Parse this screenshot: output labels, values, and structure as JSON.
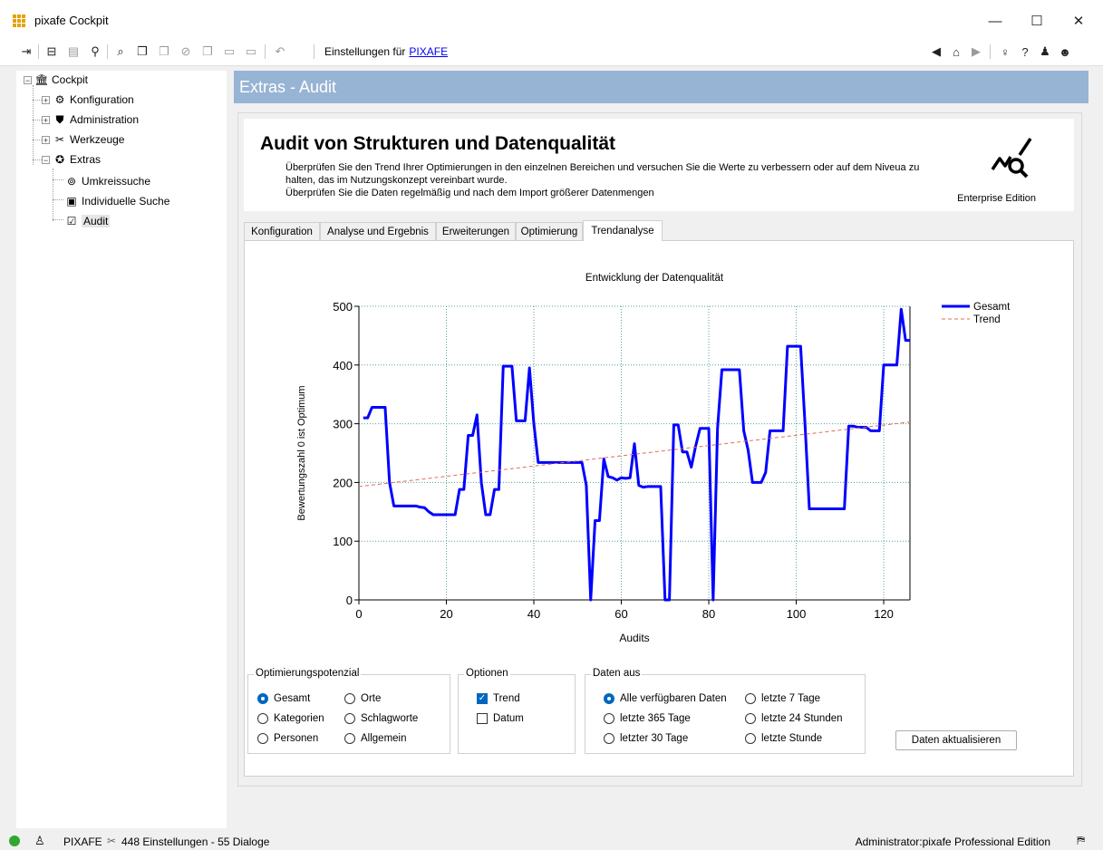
{
  "window": {
    "title": "pixafe Cockpit",
    "minimize": "—",
    "maximize": "☐",
    "close": "✕"
  },
  "toolbar": {
    "label": "Einstellungen für",
    "link": "PIXAFE"
  },
  "tree": {
    "root": "Cockpit",
    "items": [
      {
        "label": "Konfiguration",
        "icon": "gear-icon"
      },
      {
        "label": "Administration",
        "icon": "shield-icon"
      },
      {
        "label": "Werkzeuge",
        "icon": "tools-icon"
      },
      {
        "label": "Extras",
        "icon": "star-icon"
      }
    ],
    "extras_children": [
      {
        "label": "Umkreissuche",
        "icon": "location-pin-icon"
      },
      {
        "label": "Individuelle Suche",
        "icon": "search-doc-icon"
      },
      {
        "label": "Audit",
        "icon": "audit-check-icon"
      }
    ]
  },
  "page": {
    "header": "Extras - Audit",
    "title": "Audit von Strukturen und Datenqualität",
    "desc1": "Überprüfen Sie den Trend Ihrer Optimierungen in den einzelnen Bereichen und versuchen Sie die Werte zu verbessern oder auf dem Niveua zu",
    "desc2": "halten, das im Nutzungskonzept vereinbart wurde.",
    "desc3": "Überprüfen Sie die Daten regelmäßig und nach dem Import größerer Datenmengen",
    "edition": "Enterprise Edition"
  },
  "tabs": [
    "Konfiguration",
    "Analyse und Ergebnis",
    "Erweiterungen",
    "Optimierung",
    "Trendanalyse"
  ],
  "active_tab": "Trendanalyse",
  "chart_data": {
    "type": "line",
    "title": "Entwicklung der Datenqualität",
    "xlabel": "Audits",
    "ylabel": "Bewertungszahl 0 ist Optimum",
    "xlim": [
      0,
      126
    ],
    "ylim": [
      0,
      500
    ],
    "xticks": [
      0,
      20,
      40,
      60,
      80,
      100,
      120
    ],
    "yticks": [
      0,
      100,
      200,
      300,
      400,
      500
    ],
    "grid": true,
    "legend_position": "top-right",
    "series": [
      {
        "name": "Gesamt",
        "color": "#0000ff",
        "style": "solid",
        "x": [
          1,
          2,
          3,
          4,
          5,
          6,
          7,
          8,
          9,
          10,
          11,
          12,
          13,
          14,
          15,
          16,
          17,
          18,
          19,
          20,
          21,
          22,
          23,
          24,
          25,
          26,
          27,
          28,
          29,
          30,
          31,
          32,
          33,
          34,
          35,
          36,
          37,
          38,
          39,
          40,
          41,
          42,
          43,
          44,
          45,
          46,
          47,
          48,
          49,
          50,
          51,
          52,
          53,
          54,
          55,
          56,
          57,
          58,
          59,
          60,
          61,
          62,
          63,
          64,
          65,
          66,
          67,
          68,
          69,
          70,
          71,
          72,
          73,
          74,
          75,
          76,
          77,
          78,
          79,
          80,
          81,
          82,
          83,
          84,
          85,
          86,
          87,
          88,
          89,
          90,
          91,
          92,
          93,
          94,
          95,
          96,
          97,
          98,
          99,
          100,
          101,
          102,
          103,
          104,
          105,
          106,
          107,
          108,
          109,
          110,
          111,
          112,
          113,
          114,
          115,
          116,
          117,
          118,
          119,
          120,
          121,
          122,
          123,
          124,
          125,
          126
        ],
        "values": [
          310,
          310,
          328,
          328,
          328,
          328,
          200,
          160,
          160,
          160,
          160,
          160,
          160,
          158,
          157,
          150,
          145,
          145,
          145,
          145,
          145,
          145,
          188,
          188,
          280,
          280,
          315,
          200,
          145,
          145,
          188,
          188,
          398,
          398,
          398,
          305,
          305,
          305,
          395,
          300,
          234,
          234,
          234,
          234,
          234,
          234,
          234,
          234,
          234,
          234,
          234,
          195,
          0,
          135,
          135,
          240,
          210,
          208,
          204,
          208,
          207,
          208,
          266,
          195,
          192,
          193,
          193,
          193,
          193,
          0,
          0,
          298,
          298,
          252,
          252,
          226,
          262,
          292,
          292,
          292,
          0,
          292,
          392,
          392,
          392,
          392,
          392,
          288,
          255,
          200,
          200,
          200,
          217,
          288,
          288,
          288,
          288,
          432,
          432,
          432,
          432,
          300,
          155,
          155,
          155,
          155,
          155,
          155,
          155,
          155,
          155,
          296,
          296,
          294,
          294,
          294,
          288,
          288,
          288,
          400,
          400,
          400,
          400,
          495,
          442,
          442
        ]
      },
      {
        "name": "Trend",
        "color": "#e06b5a",
        "style": "dashed",
        "x": [
          0,
          126
        ],
        "values": [
          193,
          303
        ]
      }
    ]
  },
  "options": {
    "opt_group_title": "Optimierungspotenzial",
    "opt_items": [
      "Gesamt",
      "Orte",
      "Kategorien",
      "Schlagworte",
      "Personen",
      "Allgemein"
    ],
    "opt_selected": "Gesamt",
    "options_group_title": "Optionen",
    "options_items": [
      {
        "label": "Trend",
        "checked": true
      },
      {
        "label": "Datum",
        "checked": false
      }
    ],
    "data_group_title": "Daten aus",
    "data_items": [
      "Alle verfügbaren Daten",
      "letzte 7 Tage",
      "letzte 365 Tage",
      "letzte 24 Stunden",
      "letzter 30 Tage",
      "letzte Stunde"
    ],
    "data_selected": "Alle verfügbaren Daten",
    "refresh_button": "Daten aktualisieren"
  },
  "status": {
    "left": "PIXAFE",
    "settings": "448 Einstellungen - 55 Dialoge",
    "right": "Administrator:pixafe  Professional Edition"
  }
}
